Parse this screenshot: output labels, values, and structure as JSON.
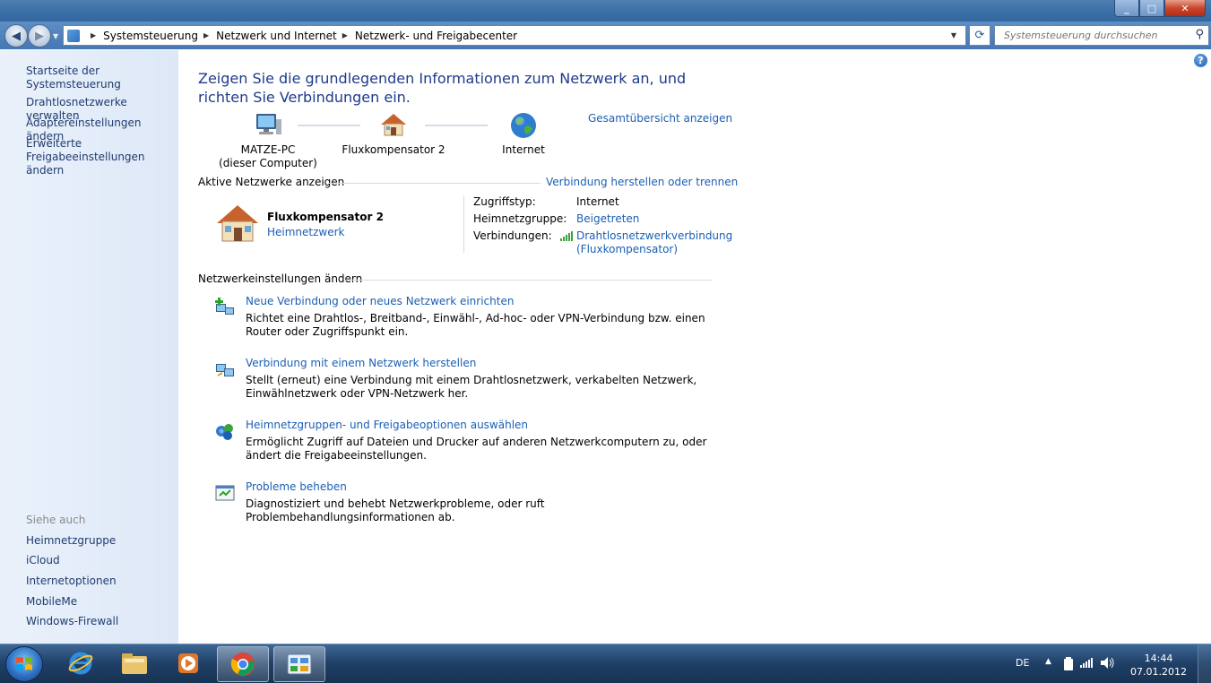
{
  "window": {
    "buttons": {
      "minimize": "_",
      "maximize": "□",
      "close": "✕"
    }
  },
  "address_bar": {
    "breadcrumbs": [
      "Systemsteuerung",
      "Netzwerk und Internet",
      "Netzwerk- und Freigabecenter"
    ],
    "search_placeholder": "Systemsteuerung durchsuchen"
  },
  "sidebar": {
    "home": "Startseite der Systemsteuerung",
    "tasks": [
      "Drahtlosnetzwerke verwalten",
      "Adaptereinstellungen ändern",
      "Erweiterte Freigabeeinstellungen ändern"
    ],
    "see_also_heading": "Siehe auch",
    "see_also": [
      "Heimnetzgruppe",
      "iCloud",
      "Internetoptionen",
      "MobileMe",
      "Windows-Firewall"
    ]
  },
  "main": {
    "headline": "Zeigen Sie die grundlegenden Informationen zum Netzwerk an, und richten Sie Verbindungen ein.",
    "full_map_link": "Gesamtübersicht anzeigen",
    "map_nodes": [
      {
        "label": "MATZE-PC",
        "sublabel": "(dieser Computer)",
        "icon": "computer-icon"
      },
      {
        "label": "Fluxkompensator  2",
        "sublabel": "",
        "icon": "home-network-icon"
      },
      {
        "label": "Internet",
        "sublabel": "",
        "icon": "globe-icon"
      }
    ],
    "active_networks_heading": "Aktive Netzwerke anzeigen",
    "connect_link": "Verbindung herstellen oder trennen",
    "active_network": {
      "name": "Fluxkompensator  2",
      "type": "Heimnetzwerk",
      "props": [
        {
          "key": "Zugriffstyp:",
          "value": "Internet",
          "link": false
        },
        {
          "key": "Heimnetzgruppe:",
          "value": "Beigetreten",
          "link": true
        },
        {
          "key": "Verbindungen:",
          "value": "Drahtlosnetzwerkverbindung\n(Fluxkompensator)",
          "link": true
        }
      ]
    },
    "change_settings_heading": "Netzwerkeinstellungen ändern",
    "tasks": [
      {
        "link": "Neue Verbindung oder neues Netzwerk einrichten",
        "desc": "Richtet eine Drahtlos-, Breitband-, Einwähl-, Ad-hoc- oder VPN-Verbindung bzw. einen Router oder Zugriffspunkt ein.",
        "icon": "new-connection-icon"
      },
      {
        "link": "Verbindung mit einem Netzwerk herstellen",
        "desc": "Stellt (erneut) eine Verbindung mit einem Drahtlosnetzwerk, verkabelten Netzwerk, Einwählnetzwerk oder VPN-Netzwerk her.",
        "icon": "connect-network-icon"
      },
      {
        "link": "Heimnetzgruppen- und Freigabeoptionen auswählen",
        "desc": "Ermöglicht Zugriff auf Dateien und Drucker auf anderen Netzwerkcomputern zu, oder ändert die Freigabeeinstellungen.",
        "icon": "homegroup-icon"
      },
      {
        "link": "Probleme beheben",
        "desc": "Diagnostiziert und behebt Netzwerkprobleme, oder ruft Problembehandlungsinformationen ab.",
        "icon": "troubleshoot-icon"
      }
    ]
  },
  "taskbar": {
    "apps": [
      "internet-explorer-icon",
      "explorer-folder-icon",
      "media-player-icon",
      "chrome-icon",
      "control-panel-icon"
    ],
    "tray": {
      "language": "DE",
      "time": "14:44",
      "date": "07.01.2012"
    }
  }
}
